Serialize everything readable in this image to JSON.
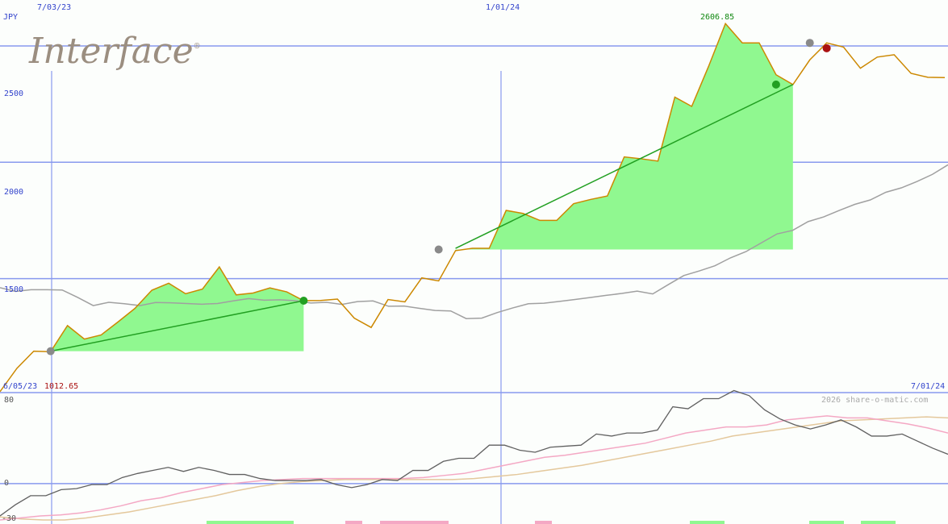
{
  "chart_data": {
    "type": "line",
    "logo": "Interface",
    "logo_mark": "®",
    "currency": "JPY",
    "date_start": "6/05/23",
    "date_end": "7/01/24",
    "start_value": "1012.65",
    "peak_label": "2606.85",
    "credit": "2026 share-o-matic.com",
    "x_date_labels": [
      "7/03/23",
      "1/01/24"
    ],
    "price_axis": {
      "ticks": [
        "1500",
        "2000",
        "2500"
      ],
      "range": [
        1010,
        2680
      ]
    },
    "osc_axis": {
      "ticks": [
        "80",
        "0",
        "-30"
      ],
      "range": [
        -40,
        90
      ]
    },
    "colors": {
      "price": "#cc8800",
      "ma": "#a0a0a0",
      "fill": "#90f890",
      "trend": "#22a022",
      "grid": "#8899ee",
      "osc_main": "#606060",
      "osc_fast": "#f4a8c4",
      "osc_slow": "#e4c89c"
    },
    "price": [
      1014,
      1114,
      1188,
      1186,
      1298,
      1240,
      1258,
      1314,
      1372,
      1450,
      1480,
      1435,
      1455,
      1550,
      1430,
      1438,
      1460,
      1443,
      1405,
      1406,
      1412,
      1330,
      1290,
      1410,
      1400,
      1503,
      1490,
      1620,
      1630,
      1630,
      1793,
      1780,
      1750,
      1750,
      1822,
      1840,
      1855,
      2023,
      2015,
      2005,
      2280,
      2240,
      2412,
      2596,
      2513,
      2513,
      2376,
      2334,
      2440,
      2513,
      2495,
      2404,
      2452,
      2462,
      2382,
      2365,
      2364
    ],
    "ma": [
      1461,
      1445,
      1452,
      1452,
      1451,
      1419,
      1384,
      1398,
      1392,
      1384,
      1397,
      1396,
      1393,
      1390,
      1393,
      1404,
      1414,
      1407,
      1409,
      1405,
      1395,
      1398,
      1389,
      1401,
      1404,
      1381,
      1382,
      1372,
      1363,
      1361,
      1328,
      1330,
      1354,
      1374,
      1392,
      1394,
      1402,
      1410,
      1419,
      1428,
      1436,
      1446,
      1434,
      1474,
      1513,
      1533,
      1555,
      1589,
      1616,
      1654,
      1692,
      1707,
      1745,
      1765,
      1793,
      1819,
      1838,
      1871,
      1890,
      1917,
      1948,
      1989
    ],
    "trend_lines": [
      {
        "from": [
          3,
          1188
        ],
        "to": [
          18,
          1405
        ]
      },
      {
        "from": [
          27,
          1630
        ],
        "to": [
          47,
          2334
        ]
      }
    ],
    "fills": [
      {
        "start": 3,
        "end": 18,
        "base": 1188
      },
      {
        "start": 27,
        "end": 47,
        "base": 1625
      }
    ],
    "markers": [
      {
        "i": 3,
        "v": 1188,
        "color": "#8a8a8a"
      },
      {
        "i": 18,
        "v": 1405,
        "color": "#22a022"
      },
      {
        "i": 26,
        "v": 1625,
        "color": "#8a8a8a"
      },
      {
        "i": 46,
        "v": 2334,
        "color": "#22a022"
      },
      {
        "i": 48,
        "v": 2513,
        "color": "#8a8a8a"
      },
      {
        "i": 49,
        "v": 2490,
        "color": "#aa1111"
      }
    ],
    "osc_main": [
      -32,
      -21,
      -12,
      -12,
      -6,
      -5,
      -1,
      -1,
      6,
      10,
      13,
      16,
      12,
      16,
      13,
      9,
      9,
      5,
      3,
      3,
      3,
      4,
      -1,
      -4,
      -1,
      4,
      3,
      13,
      13,
      22,
      25,
      25,
      38,
      38,
      33,
      31,
      36,
      37,
      38,
      49,
      47,
      50,
      50,
      53,
      76,
      74,
      84,
      84,
      92,
      87,
      73,
      64,
      58,
      54,
      58,
      63,
      56,
      47,
      47,
      49,
      42,
      35,
      29
    ],
    "osc_fast": [
      -36,
      -34,
      -32,
      -31,
      -29,
      -26,
      -22,
      -17,
      -14,
      -9,
      -5,
      -1,
      1,
      3,
      4,
      5,
      5,
      5,
      5,
      5,
      5,
      6,
      8,
      10,
      14,
      18,
      22,
      26,
      28,
      31,
      34,
      37,
      40,
      45,
      50,
      53,
      56,
      56,
      58,
      63,
      65,
      67,
      65,
      65,
      62,
      59,
      55,
      50
    ],
    "osc_slow": [
      -33,
      -35,
      -36,
      -36,
      -34,
      -31,
      -28,
      -24,
      -20,
      -16,
      -12,
      -7,
      -3,
      0,
      2,
      3,
      4,
      4,
      4,
      4,
      4,
      4,
      5,
      7,
      9,
      12,
      15,
      18,
      22,
      26,
      30,
      34,
      38,
      42,
      47,
      50,
      53,
      56,
      59,
      62,
      63,
      64,
      65,
      66,
      65
    ],
    "osc_bars": [
      {
        "from": 256,
        "to": 364,
        "color": "#90f890"
      },
      {
        "from": 320,
        "to": 342,
        "color": "#90f890"
      },
      {
        "from": 428,
        "to": 449,
        "color": "#f4a8c4"
      },
      {
        "from": 471,
        "to": 556,
        "color": "#f4a8c4"
      },
      {
        "from": 663,
        "to": 684,
        "color": "#f4a8c4"
      },
      {
        "from": 855,
        "to": 898,
        "color": "#90f890"
      },
      {
        "from": 1003,
        "to": 1046,
        "color": "#90f890"
      },
      {
        "from": 1067,
        "to": 1110,
        "color": "#90f890"
      }
    ]
  }
}
